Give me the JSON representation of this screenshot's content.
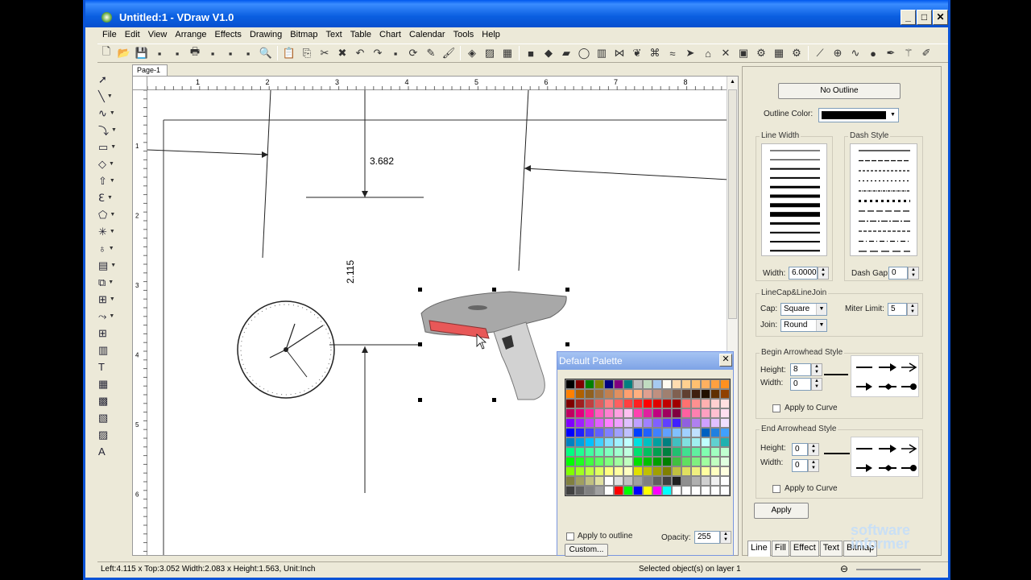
{
  "window": {
    "title": "Untitled:1 - VDraw V1.0",
    "min": "_",
    "max": "□",
    "close": "✕"
  },
  "menu": [
    "File",
    "Edit",
    "View",
    "Arrange",
    "Effects",
    "Drawing",
    "Bitmap",
    "Text",
    "Table",
    "Chart",
    "Calendar",
    "Tools",
    "Help"
  ],
  "toolbar_icons": [
    "new-icon",
    "open-icon",
    "save-icon",
    "save-as-icon",
    "print-preview-icon",
    "print-icon",
    "copy-page-icon",
    "page-icon",
    "spell-icon",
    "zoom-icon",
    "|",
    "paste-icon",
    "copy-icon",
    "cut-icon",
    "delete-icon",
    "undo-icon",
    "redo-icon",
    "align-icon",
    "rotate-icon",
    "eyedropper-icon",
    "brush-icon",
    "|",
    "fill-icon",
    "gradient-icon",
    "grid-icon",
    "|",
    "cube-icon",
    "block-icon",
    "eraser-icon",
    "cylinder-icon",
    "barrel-icon",
    "flip-icon",
    "leaf-icon",
    "knot-icon",
    "wave-icon",
    "arrow-shape-icon",
    "house-icon",
    "cross-icon",
    "frame-icon",
    "gear-icon",
    "table-icon",
    "settings-icon",
    "|",
    "line-tool-icon",
    "magnify-icon",
    "lasso-icon",
    "sphere-icon",
    "pen-icon",
    "wand-icon",
    "brush2-icon"
  ],
  "left_tools": [
    "pointer-icon",
    "line-icon",
    "curve-icon",
    "arrow-icon",
    "rectangle-icon",
    "diamond-icon",
    "up-arrow-icon",
    "ruler-icon",
    "polygon-icon",
    "star-icon",
    "callout-icon",
    "cylinder-icon",
    "flowchart-icon",
    "org-chart-icon",
    "connector-icon",
    "table-icon",
    "chart-icon",
    "text-icon",
    "texture-icon",
    "image-icon",
    "color-fill-icon",
    "picture-icon",
    "wordart-icon"
  ],
  "page_tab": "Page-1",
  "ruler": {
    "h": [
      "1",
      "2",
      "3",
      "4",
      "5",
      "6",
      "7",
      "8"
    ],
    "v": [
      "1",
      "2",
      "3",
      "4",
      "5",
      "6"
    ]
  },
  "dimensions": {
    "d1": "3.682",
    "d2": "2.115"
  },
  "palette": {
    "title": "Default Palette",
    "close": "✕",
    "apply_outline": "Apply to outline",
    "opacity_label": "Opacity:",
    "opacity_value": "255",
    "custom": "Custom..."
  },
  "panel": {
    "no_outline": "No Outline",
    "outline_color_label": "Outline Color:",
    "line_width_label": "Line Width",
    "dash_style_label": "Dash Style",
    "width_label": "Width:",
    "width_value": "6.0000",
    "dash_gap_label": "Dash Gap:",
    "dash_gap_value": "0",
    "linecap_label": "LineCap&LineJoin",
    "cap_label": "Cap:",
    "cap_value": "Square",
    "join_label": "Join:",
    "join_value": "Round",
    "miter_label": "Miter Limit:",
    "miter_value": "5",
    "begin_label": "Begin Arrowhead Style",
    "begin_height_label": "Height:",
    "begin_height": "8",
    "begin_width_label": "Width:",
    "begin_width": "0",
    "begin_apply": "Apply to Curve",
    "end_label": "End Arrowhead Style",
    "end_height_label": "Height:",
    "end_height": "0",
    "end_width_label": "Width:",
    "end_width": "0",
    "end_apply": "Apply to Curve",
    "apply": "Apply",
    "tabs": [
      "Line",
      "Fill",
      "Effect",
      "Text",
      "Bitmap"
    ]
  },
  "status": {
    "left": "Left:4.115 x Top:3.052   Width:2.083 x Height:1.563, Unit:Inch",
    "right": "Selected object(s) on layer 1"
  },
  "watermark": {
    "line1": "software",
    "line2": "informer"
  }
}
